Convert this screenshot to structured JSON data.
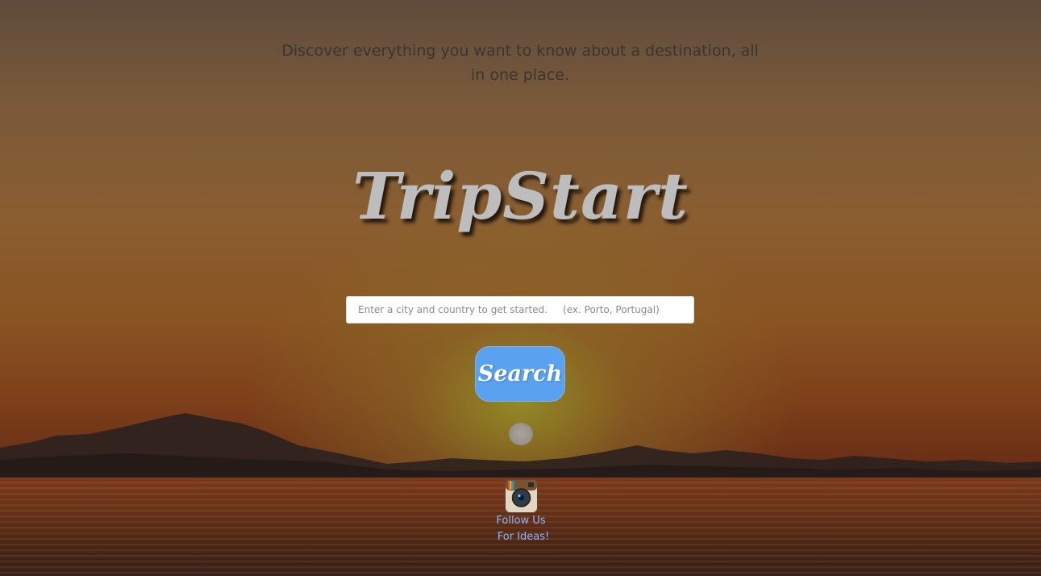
{
  "header": {
    "tagline": "Discover everything you want to know about a destination, all in one place."
  },
  "brand": {
    "title": "TripStart"
  },
  "search": {
    "placeholder": "Enter a city and country to get started.     (ex. Porto, Portugal)",
    "value": "",
    "button_label": "Search"
  },
  "social": {
    "icon": "instagram-icon",
    "follow_line1": "Follow Us",
    "follow_line2": "For Ideas!"
  },
  "colors": {
    "button_bg": "#5aa2f0",
    "link_color": "#8ab8ff",
    "brand_text": "#bdbdbd"
  }
}
